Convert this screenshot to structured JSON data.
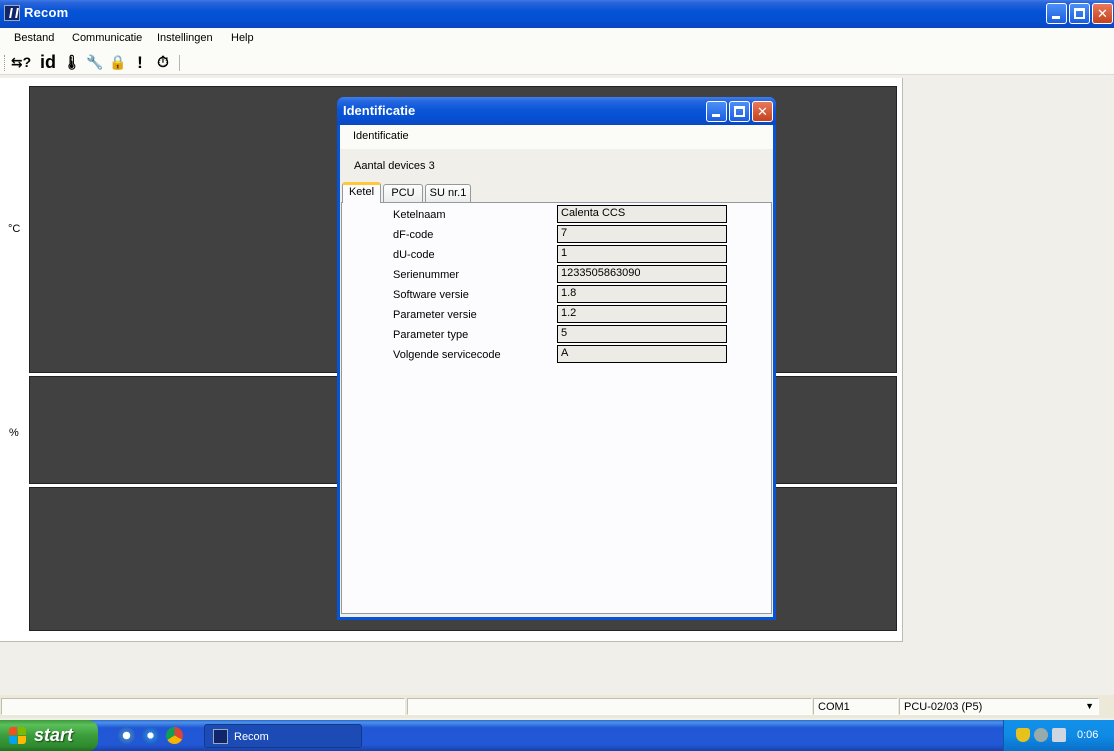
{
  "window": {
    "title": "Recom"
  },
  "menu": {
    "items": [
      {
        "label": "Bestand"
      },
      {
        "label": "Communicatie"
      },
      {
        "label": "Instellingen"
      },
      {
        "label": "Help"
      }
    ]
  },
  "toolbar": {
    "buttons": [
      {
        "glyph": "⇆?",
        "icon": "connect-help-icon"
      },
      {
        "glyph": "id",
        "icon": "id-icon"
      },
      {
        "glyph": "🌡",
        "icon": "thermometer-icon"
      },
      {
        "glyph": "🔧",
        "icon": "wrench-icon"
      },
      {
        "glyph": "🔒",
        "icon": "lock-icon"
      },
      {
        "glyph": "!",
        "icon": "alert-icon"
      },
      {
        "glyph": "⏱",
        "icon": "stopwatch-icon"
      }
    ]
  },
  "graph": {
    "unit_temp": "°C",
    "unit_percent": "%"
  },
  "dialog": {
    "title": "Identificatie",
    "menu_label": "Identificatie",
    "devices_label": "Aantal devices 3",
    "tabs": [
      {
        "label": "Ketel",
        "active": true
      },
      {
        "label": "PCU",
        "active": false
      },
      {
        "label": "SU nr.1",
        "active": false
      }
    ],
    "fields": [
      {
        "label": "Ketelnaam",
        "value": "Calenta CCS"
      },
      {
        "label": "dF-code",
        "value": "7"
      },
      {
        "label": "dU-code",
        "value": "1"
      },
      {
        "label": "Serienummer",
        "value": "1233505863090"
      },
      {
        "label": "Software versie",
        "value": "1.8"
      },
      {
        "label": "Parameter versie",
        "value": "1.2"
      },
      {
        "label": "Parameter type",
        "value": "5"
      },
      {
        "label": "Volgende servicecode",
        "value": "A"
      }
    ]
  },
  "statusbar": {
    "port": "COM1",
    "device": "PCU-02/03 (P5)"
  },
  "taskbar": {
    "start_label": "start",
    "task_label": "Recom",
    "clock": "0:06"
  },
  "colors": {
    "title_blue": "#0553d6",
    "graph_bg": "#414141",
    "start_green": "#3a9d3a"
  }
}
